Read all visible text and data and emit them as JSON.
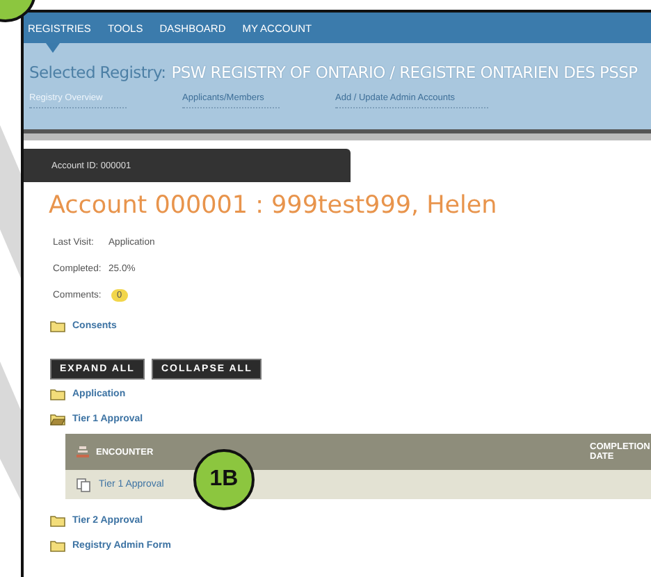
{
  "nav": {
    "items": [
      "REGISTRIES",
      "TOOLS",
      "DASHBOARD",
      "MY ACCOUNT"
    ]
  },
  "registry": {
    "label": "Selected Registry:",
    "name": "PSW REGISTRY OF ONTARIO / REGISTRE ONTARIEN DES PSSP"
  },
  "subnav": [
    {
      "label": "Registry Overview",
      "selected": true
    },
    {
      "label": "Applicants/Members",
      "selected": false
    },
    {
      "label": "Add / Update Admin Accounts",
      "selected": false
    }
  ],
  "account_tab": "Account ID: 000001",
  "account_title": "Account 000001 : 999test999, Helen",
  "details": [
    {
      "label": "Last Visit:",
      "value": "Application",
      "kind": "text"
    },
    {
      "label": "Completed:",
      "value": "25.0%",
      "kind": "text"
    },
    {
      "label": "Comments:",
      "value": "0",
      "kind": "badge"
    }
  ],
  "consents": {
    "label": "Consents",
    "expanded": false
  },
  "buttons": [
    "EXPAND ALL",
    "COLLAPSE ALL"
  ],
  "tree": [
    {
      "label": "Application",
      "expanded": false
    },
    {
      "label": "Tier 1 Approval",
      "expanded": true,
      "table": {
        "columns": [
          "ENCOUNTER",
          "COMPLETION DATE"
        ],
        "rows": [
          {
            "encounter": "Tier 1 Approval"
          }
        ]
      }
    },
    {
      "label": "Tier 2 Approval",
      "expanded": false
    },
    {
      "label": "Registry Admin Form",
      "expanded": false
    }
  ],
  "callouts": [
    {
      "kind": "corner"
    },
    {
      "kind": "row",
      "label": "1B"
    }
  ]
}
